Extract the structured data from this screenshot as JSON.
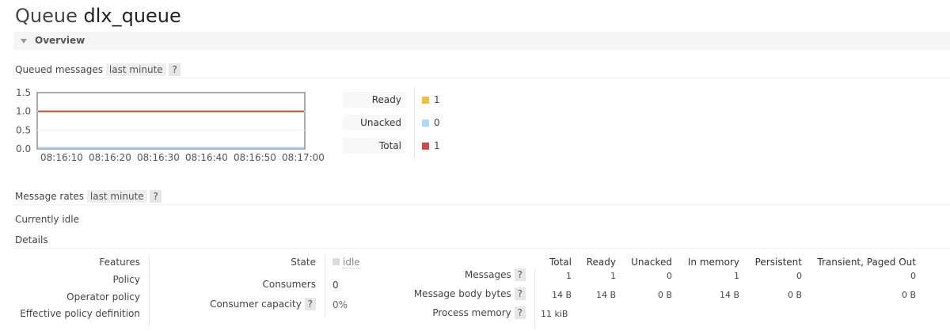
{
  "title": {
    "prefix": "Queue",
    "name": "dlx_queue"
  },
  "overview_label": "Overview",
  "queued": {
    "label": "Queued messages",
    "range": "last minute",
    "help": "?"
  },
  "legend": [
    {
      "label": "Ready",
      "value": "1",
      "color": "#edc240"
    },
    {
      "label": "Unacked",
      "value": "0",
      "color": "#afd8f8"
    },
    {
      "label": "Total",
      "value": "1",
      "color": "#cb4b4b"
    }
  ],
  "chart_data": {
    "type": "line",
    "x": [
      "08:16:10",
      "08:16:20",
      "08:16:30",
      "08:16:40",
      "08:16:50",
      "08:17:00"
    ],
    "yticks": [
      "1.5",
      "1.0",
      "0.5",
      "0.0"
    ],
    "ylim": [
      0,
      1.5
    ],
    "series": [
      {
        "name": "Ready",
        "color": "#edc240",
        "values": [
          1,
          1,
          1,
          1,
          1,
          1
        ]
      },
      {
        "name": "Unacked",
        "color": "#afd8f8",
        "values": [
          0,
          0,
          0,
          0,
          0,
          0
        ]
      },
      {
        "name": "Total",
        "color": "#cb4b4b",
        "values": [
          1,
          1,
          1,
          1,
          1,
          1
        ]
      }
    ]
  },
  "rates": {
    "label": "Message rates",
    "range": "last minute",
    "help": "?"
  },
  "idle_text": "Currently idle",
  "details_label": "Details",
  "details": {
    "col1": [
      "Features",
      "Policy",
      "Operator policy",
      "Effective policy definition"
    ],
    "state_label": "State",
    "state_value": "idle",
    "consumers_label": "Consumers",
    "consumers_value": "0",
    "capacity_label": "Consumer capacity",
    "capacity_value": "0%",
    "help": "?",
    "stats_headers": [
      "Total",
      "Ready",
      "Unacked",
      "In memory",
      "Persistent",
      "Transient, Paged Out"
    ],
    "stats_rows": [
      {
        "label": "Messages",
        "values": [
          "1",
          "1",
          "0",
          "1",
          "0",
          "0"
        ]
      },
      {
        "label": "Message body bytes",
        "values": [
          "14 B",
          "14 B",
          "0 B",
          "14 B",
          "0 B",
          "0 B"
        ]
      },
      {
        "label": "Process memory",
        "values": [
          "11 kiB"
        ]
      }
    ]
  }
}
